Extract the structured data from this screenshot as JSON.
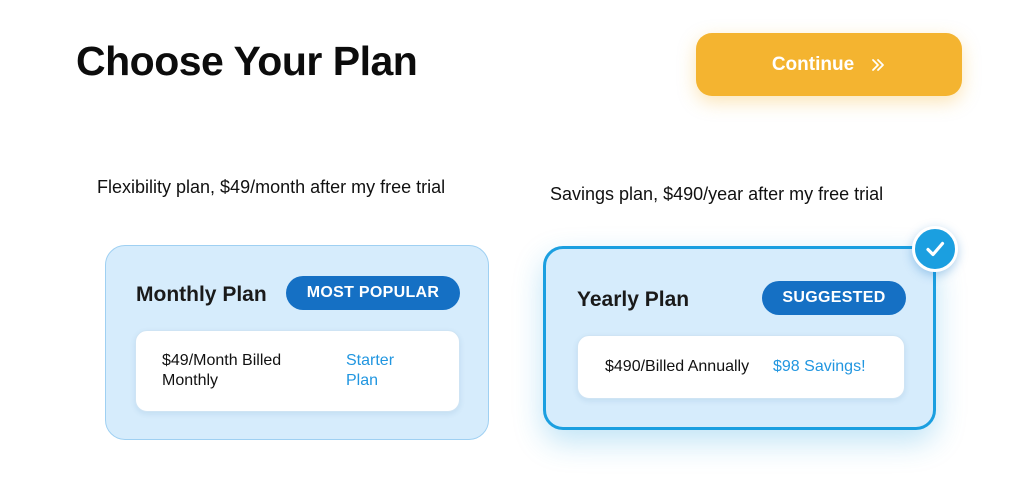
{
  "header": {
    "title": "Choose Your Plan",
    "continue_label": "Continue",
    "continue_icon": "double-chevron-right-icon"
  },
  "colors": {
    "accent_yellow": "#f4b430",
    "badge_blue": "#1570c4",
    "selected_border": "#1b9fe0",
    "accent_text": "#2196e0",
    "card_background": "#d6ecfc"
  },
  "plans": [
    {
      "caption": "Flexibility plan, $49/month after my free trial",
      "name": "Monthly Plan",
      "badge": "MOST POPULAR",
      "price": "$49/Month Billed Monthly",
      "accent": "Starter Plan",
      "selected": false
    },
    {
      "caption": "Savings plan, $490/year after my free trial",
      "name": "Yearly Plan",
      "badge": "SUGGESTED",
      "price": "$490/Billed Annually",
      "accent": "$98 Savings!",
      "selected": true,
      "selected_icon": "checkmark-icon"
    }
  ]
}
